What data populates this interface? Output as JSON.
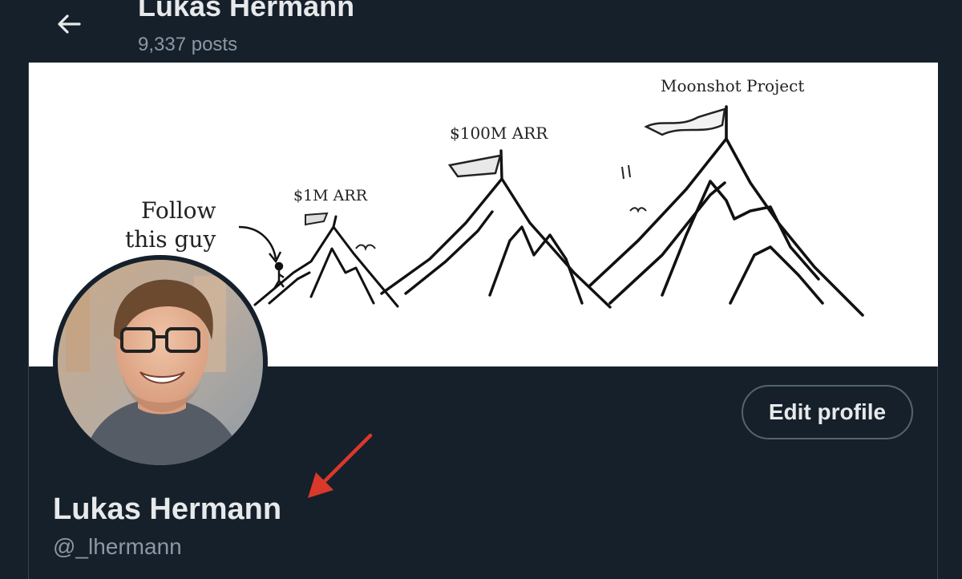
{
  "header": {
    "back_icon": "arrow-left-icon",
    "name": "Lukas Hermann",
    "posts_count": "9,337 posts"
  },
  "banner": {
    "label_moonshot": "Moonshot Project",
    "label_100m": "$100M ARR",
    "label_1m": "$1M ARR",
    "label_follow_line1": "Follow",
    "label_follow_line2": "this guy"
  },
  "profile": {
    "edit_button_label": "Edit profile",
    "display_name": "Lukas Hermann",
    "handle": "@_lhermann"
  },
  "colors": {
    "background": "#15202b",
    "primary_text": "#e7e9ea",
    "secondary_text": "#8b98a5",
    "annotation_arrow": "#d9382a"
  }
}
